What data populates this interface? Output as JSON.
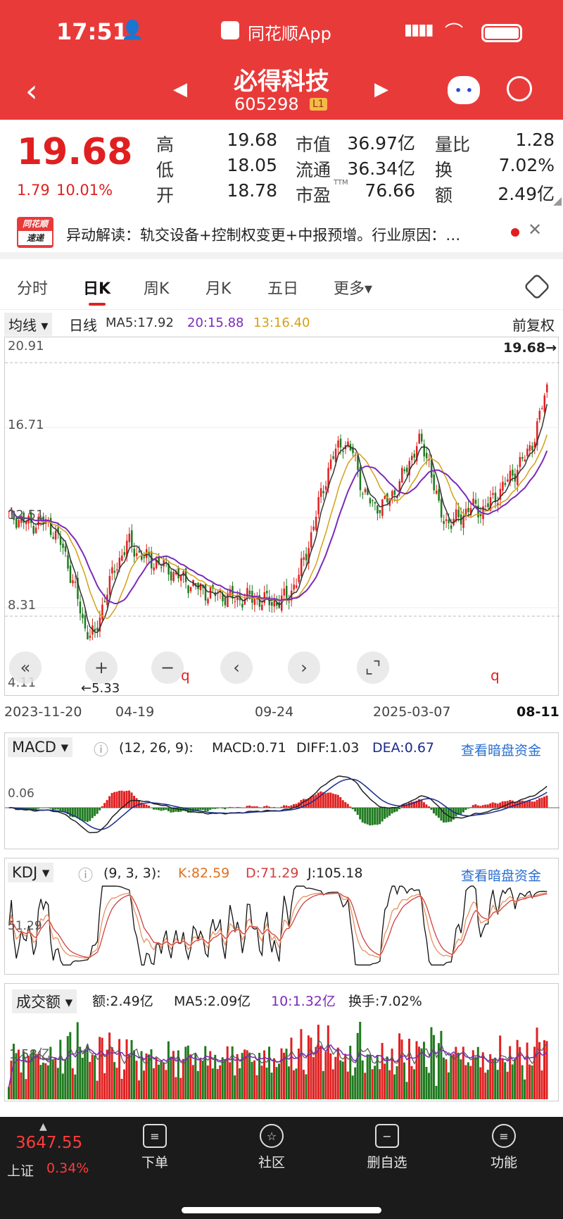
{
  "status": {
    "time": "17:51",
    "app_name": "同花顺App"
  },
  "stock": {
    "name": "必得科技",
    "code": "605298",
    "level_badge": "L1"
  },
  "quote": {
    "price": "19.68",
    "change": "1.79",
    "change_pct": "10.01%",
    "high_label": "高",
    "high": "19.68",
    "low_label": "低",
    "low": "18.05",
    "open_label": "开",
    "open": "18.78",
    "mcap_label": "市值",
    "mcap": "36.97亿",
    "float_label": "流通",
    "float": "36.34亿",
    "pe_label": "市盈",
    "pe_sup": "TTM",
    "pe": "76.66",
    "vr_label": "量比",
    "vr": "1.28",
    "turnover_label": "换",
    "turnover": "7.02%",
    "amount_label": "额",
    "amount": "2.49亿"
  },
  "news": {
    "badge_top": "同花顺",
    "badge_bottom": "速递",
    "text": "异动解读：轨交设备+控制权变更+中报预增。行业原因：…"
  },
  "tabs": [
    {
      "label": "分时"
    },
    {
      "label": "日K"
    },
    {
      "label": "周K"
    },
    {
      "label": "月K"
    },
    {
      "label": "五日"
    },
    {
      "label": "更多▾"
    }
  ],
  "indicators": {
    "dropdown": "均线",
    "period": "日线",
    "ma5": "MA5:17.92",
    "ma20": "20:15.88",
    "ma13": "13:16.40",
    "adjust": "前复权"
  },
  "kline": {
    "y_ticks": [
      "20.91",
      "16.71",
      "12.51",
      "8.31",
      "4.11"
    ],
    "last_price_marker": "19.68→",
    "low_marker": "←5.33",
    "q_marker": "q",
    "x_ticks": [
      "2023-11-20",
      "04-19",
      "09-24",
      "2025-03-07",
      "08-11"
    ]
  },
  "macd": {
    "name": "MACD",
    "params": "(12, 26, 9):",
    "macd": "MACD:0.71",
    "diff": "DIFF:1.03",
    "dea": "DEA:0.67",
    "link": "查看暗盘资金",
    "tick": "0.06"
  },
  "kdj": {
    "name": "KDJ",
    "params": "(9, 3, 3):",
    "k": "K:82.59",
    "d": "D:71.29",
    "j": "J:105.18",
    "link": "查看暗盘资金",
    "tick": "51.29"
  },
  "volume": {
    "name": "成交额",
    "amount": "额:2.49亿",
    "ma5": "MA5:2.09亿",
    "ma10": "10:1.32亿",
    "turnover": "换手:7.02%",
    "tick": "1.58亿"
  },
  "index": {
    "value": "3647.55",
    "name": "上证",
    "pct": "0.34%"
  },
  "nav": [
    {
      "label": "下单",
      "icon": "order-icon"
    },
    {
      "label": "社区",
      "icon": "community-icon"
    },
    {
      "label": "删自选",
      "icon": "remove-watchlist-icon"
    },
    {
      "label": "功能",
      "icon": "menu-icon"
    }
  ],
  "colors": {
    "brand_red": "#e93a3a",
    "up": "#e02020",
    "down": "#1f7a1f",
    "ma20": "#7a2bb8",
    "ma13": "#d4a017"
  },
  "chart_data": {
    "type": "candlestick",
    "title": "",
    "x_ticks": [
      "2023-11-20",
      "04-19",
      "09-24",
      "2025-03-07",
      "08-11"
    ],
    "ylim": [
      4.11,
      20.91
    ],
    "close_series_approx": [
      12.3,
      12.1,
      11.8,
      12.0,
      11.6,
      10.5,
      8.5,
      6.0,
      5.5,
      8.0,
      9.5,
      10.8,
      10.2,
      9.8,
      9.6,
      9.2,
      8.8,
      8.4,
      8.1,
      7.9,
      7.8,
      7.6,
      7.7,
      7.6,
      7.5,
      7.4,
      7.8,
      9.0,
      11.0,
      13.5,
      15.5,
      16.5,
      15.8,
      13.5,
      12.8,
      13.0,
      13.8,
      15.0,
      16.5,
      15.5,
      12.5,
      11.8,
      12.3,
      12.8,
      12.6,
      13.2,
      14.0,
      14.8,
      15.6,
      17.0,
      19.68
    ],
    "series": [
      {
        "name": "MA5",
        "last": 17.92
      },
      {
        "name": "20",
        "last": 15.88
      },
      {
        "name": "13",
        "last": 16.4
      }
    ]
  }
}
